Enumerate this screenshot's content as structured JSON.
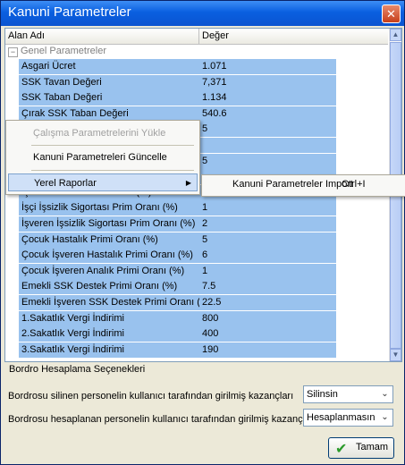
{
  "window": {
    "title": "Kanuni Parametreler",
    "close": "✕"
  },
  "grid": {
    "col_name": "Alan Adı",
    "col_value": "Değer",
    "group_label": "Genel Parametreler",
    "rows": [
      {
        "name": "Asgari Ücret",
        "value": "1.071"
      },
      {
        "name": "SSK Tavan Değeri",
        "value": "7,371"
      },
      {
        "name": "SSK Taban Değeri",
        "value": "1.134"
      },
      {
        "name": "Çırak SSK Taban Değeri",
        "value": "540.6"
      },
      {
        "name": "",
        "value": "5"
      },
      {
        "name": "",
        "value": ""
      },
      {
        "name": "",
        "value": "5"
      },
      {
        "name": "",
        "value": ""
      },
      {
        "name": "İşveren Analık Prim Oranı (%)",
        "value": "1"
      },
      {
        "name": "İşçi İşsizlik Sigortası Prim Oranı (%)",
        "value": "1"
      },
      {
        "name": "İşveren İşsizlik Sigortası Prim Oranı (%)",
        "value": "2"
      },
      {
        "name": "Çocuk Hastalık Primi Oranı (%)",
        "value": "5"
      },
      {
        "name": "Çocuk İşveren Hastalık Primi Oranı (%)",
        "value": "6"
      },
      {
        "name": "Çocuk İşveren Analık Primi  Oranı (%)",
        "value": "1"
      },
      {
        "name": "Emekli SSK Destek Primi Oranı (%)",
        "value": "7.5"
      },
      {
        "name": "Emekli İşveren SSK Destek Primi Oranı (%",
        "value": "22.5"
      },
      {
        "name": "1.Sakatlık Vergi İndirimi",
        "value": "800"
      },
      {
        "name": "2.Sakatlık Vergi İndirimi",
        "value": "400"
      },
      {
        "name": "3.Sakatlık Vergi İndirimi",
        "value": "190"
      }
    ]
  },
  "context_menu": {
    "items": [
      {
        "label": "Çalışma Parametrelerini Yükle",
        "enabled": false
      },
      {
        "label": "Kanuni Parametreleri Güncelle",
        "enabled": true
      },
      {
        "label": "Yerel Raporlar",
        "enabled": true,
        "submenu": true
      }
    ],
    "submenu": {
      "label": "Kanuni Parametreler Import",
      "shortcut": "Ctrl+I"
    }
  },
  "options": {
    "section_title": "Bordro Hesaplama Seçenekleri",
    "deleted_label": "Bordrosu silinen personelin kullanıcı tarafından girilmiş kazançları",
    "deleted_value": "Silinsin",
    "calculated_label": "Bordrosu hesaplanan personelin kullanıcı tarafından girilmiş kazançları",
    "calculated_value": "Hesaplanmasın"
  },
  "ok_button": {
    "label": "Tamam"
  },
  "icons": {
    "ok": "check-icon",
    "close": "close-icon",
    "expand": "collapse-icon"
  }
}
